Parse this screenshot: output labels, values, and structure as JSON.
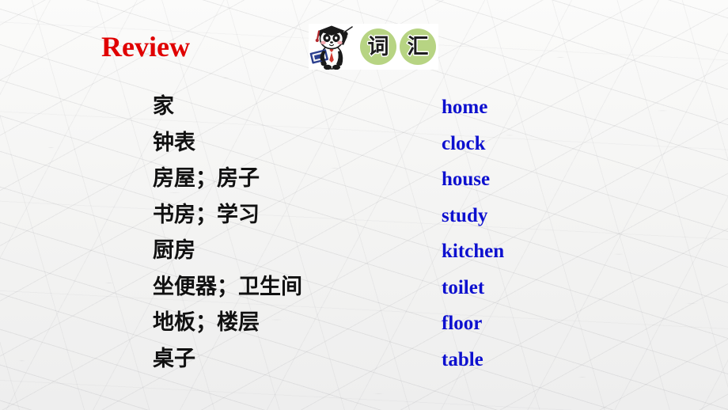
{
  "slide": {
    "title": "Review",
    "title_color": "#e00000",
    "background_color": "#f5f5f4",
    "english_color": "#0d10cf",
    "chinese_color": "#111111"
  },
  "vocab_graphic": {
    "icon_name": "panda-teacher-icon",
    "chip_color": "#b7d483",
    "chips": [
      {
        "char": "词"
      },
      {
        "char": "汇"
      }
    ]
  },
  "word_list": [
    {
      "cn": "家",
      "en": "home"
    },
    {
      "cn": "钟表",
      "en": "clock"
    },
    {
      "cn": "房屋；房子",
      "en": "house"
    },
    {
      "cn": "书房；学习",
      "en": "study"
    },
    {
      "cn": "厨房",
      "en": "kitchen"
    },
    {
      "cn": "坐便器；卫生间",
      "en": "toilet"
    },
    {
      "cn": "地板；楼层",
      "en": "floor"
    },
    {
      "cn": "桌子",
      "en": "table"
    }
  ]
}
